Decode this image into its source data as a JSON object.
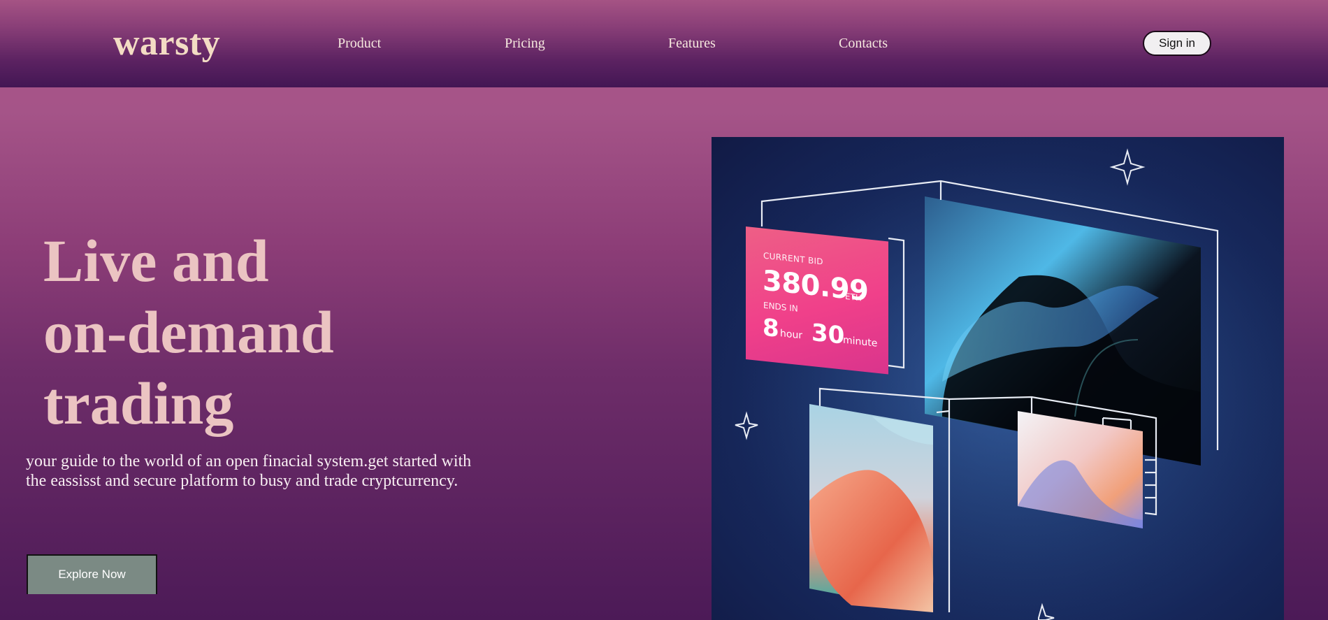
{
  "header": {
    "logo": "warsty",
    "nav": [
      "Product",
      "Pricing",
      "Features",
      "Contacts"
    ],
    "signin_label": "Sign in"
  },
  "hero": {
    "title_lines": [
      "Live and",
      "on-demand",
      "trading"
    ],
    "subtitle": "your guide to the world of an open finacial system.get started with the eassisst and secure platform to busy and trade cryptcurrency.",
    "cta_label": "Explore Now"
  },
  "artwork": {
    "bid_label": "CURRENT BID",
    "bid_value": "380.99",
    "bid_unit": "ETH",
    "ends_label": "ENDS IN",
    "hours": "8",
    "hours_unit": "hour",
    "minutes": "30",
    "minutes_unit": "minute"
  },
  "colors": {
    "logo": "#f3dcc4",
    "hero_title": "#ebc4c2",
    "cta_bg": "#7b8a84",
    "card_pink": "#f0408a",
    "art_bg": "#1f3a72"
  },
  "icons": [
    "sparkle-icon"
  ]
}
